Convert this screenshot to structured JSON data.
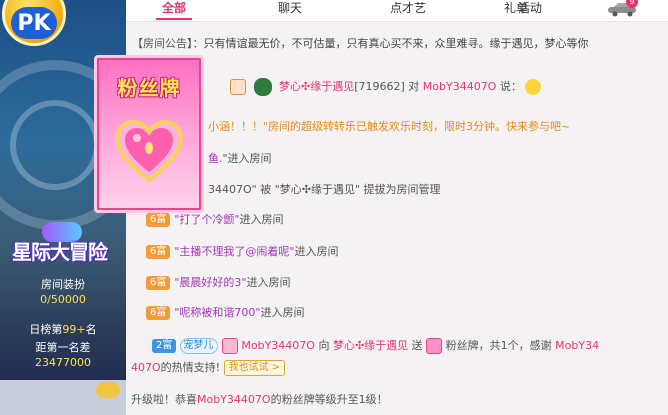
{
  "left": {
    "pk_label": "PK",
    "event_title": "星际大冒险",
    "room_decor_label": "房间装扮",
    "room_decor_value": "0/50000",
    "daily_rank_prefix": "日榜第",
    "daily_rank_num": "99+",
    "daily_rank_suffix": "名",
    "gap_label": "距第一名差",
    "gap_value": "23477000"
  },
  "tabs": [
    {
      "label": "全部",
      "active": true
    },
    {
      "label": "聊天"
    },
    {
      "label": "点才艺"
    },
    {
      "label": "礼单"
    },
    {
      "label": "活动"
    }
  ],
  "car_badge": "9",
  "notice": {
    "tag": "【房间公告】：",
    "text": "只有情谊最无价，不可估量，只有真心买不来，众里难寻。缘于遇见，梦心等你"
  },
  "fan_card_title": "粉丝牌",
  "messages": {
    "m1_user": "梦心✣缘于遇见",
    "m1_id": "[719662]",
    "m1_to": " 对 ",
    "m1_target": "MobY34407O",
    "m1_say": " 说：",
    "m2": "小涵！！！\"房间的超级转转乐已触发欢乐时刻，限时3分钟。快来参与吧~",
    "m3_name": "鱼.",
    "m3_rest": "\"进入房间",
    "m4": "34407O\" 被 \"梦心✣缘于遇见\" 提拔为房间管理",
    "m5_badge": "6富",
    "m5_name": "\"打了个冷颤\"",
    "m5_rest": "进入房间",
    "m6_badge": "6富",
    "m6_name": "\"主播不理我了@闹着呢\"",
    "m6_rest": "进入房间",
    "m7_badge": "6富",
    "m7_name": "\"晨晨好好的3\"",
    "m7_rest": "进入房间",
    "m8_badge": "6富",
    "m8_name": "\"呢称被和谐700\"",
    "m8_rest": "进入房间",
    "m9_badge": "2富",
    "m9_tag": "宠梦儿",
    "m9_user": "MobY34407O",
    "m9_to": " 向 ",
    "m9_host": "梦心✣缘于遇见",
    "m9_send": " 送 ",
    "m9_gift": " 粉丝牌，共1个，感谢 ",
    "m9_thanks_user": "MobY34",
    "m9_line2_user": "407O",
    "m9_line2_rest": "的热情支持!",
    "m9_try": "我也试试 >",
    "m10_prefix": "升级啦！恭喜",
    "m10_user": "MobY34407O",
    "m10_rest": "的粉丝牌等级升至1级！"
  },
  "colors": {
    "accent": "#e8336d",
    "orange": "#f29b3a",
    "blue": "#3b94e0"
  }
}
